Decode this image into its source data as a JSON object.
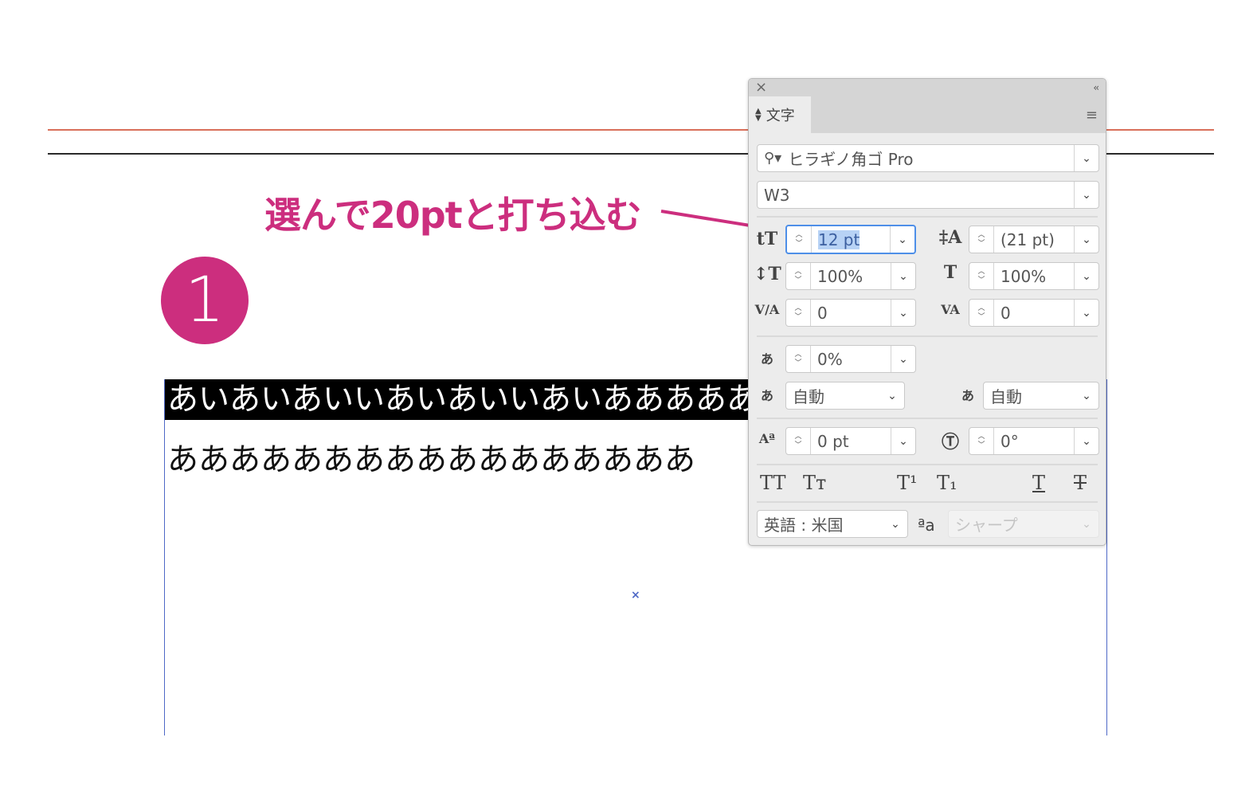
{
  "annotation": {
    "text": "選んで20ptと打ち込む",
    "step_number": "1"
  },
  "canvas": {
    "line1_text": "あいあいあいいあいあいいあいあああああ",
    "line2_text": "あああああああああああああああああ",
    "center_mark": "×"
  },
  "panel": {
    "close": "×",
    "collapse": "‹‹",
    "tab_label": "文字",
    "menu_icon": "≡",
    "font_family": "ヒラギノ角ゴ Pro",
    "font_style": "W3",
    "font_size": "12 pt",
    "leading": "(21 pt)",
    "vertical_scale": "100%",
    "horizontal_scale": "100%",
    "kerning": "0",
    "tracking": "0",
    "tsume": "0%",
    "aki_left": "自動",
    "aki_right": "自動",
    "baseline_shift": "0 pt",
    "rotation": "0°",
    "language": "英語 : 米国",
    "antialias": "シャープ",
    "aa_icon": "ªa"
  },
  "colors": {
    "accent": "#cc2e7e",
    "frame": "#4e68c6",
    "focus": "#4e8fe8"
  }
}
